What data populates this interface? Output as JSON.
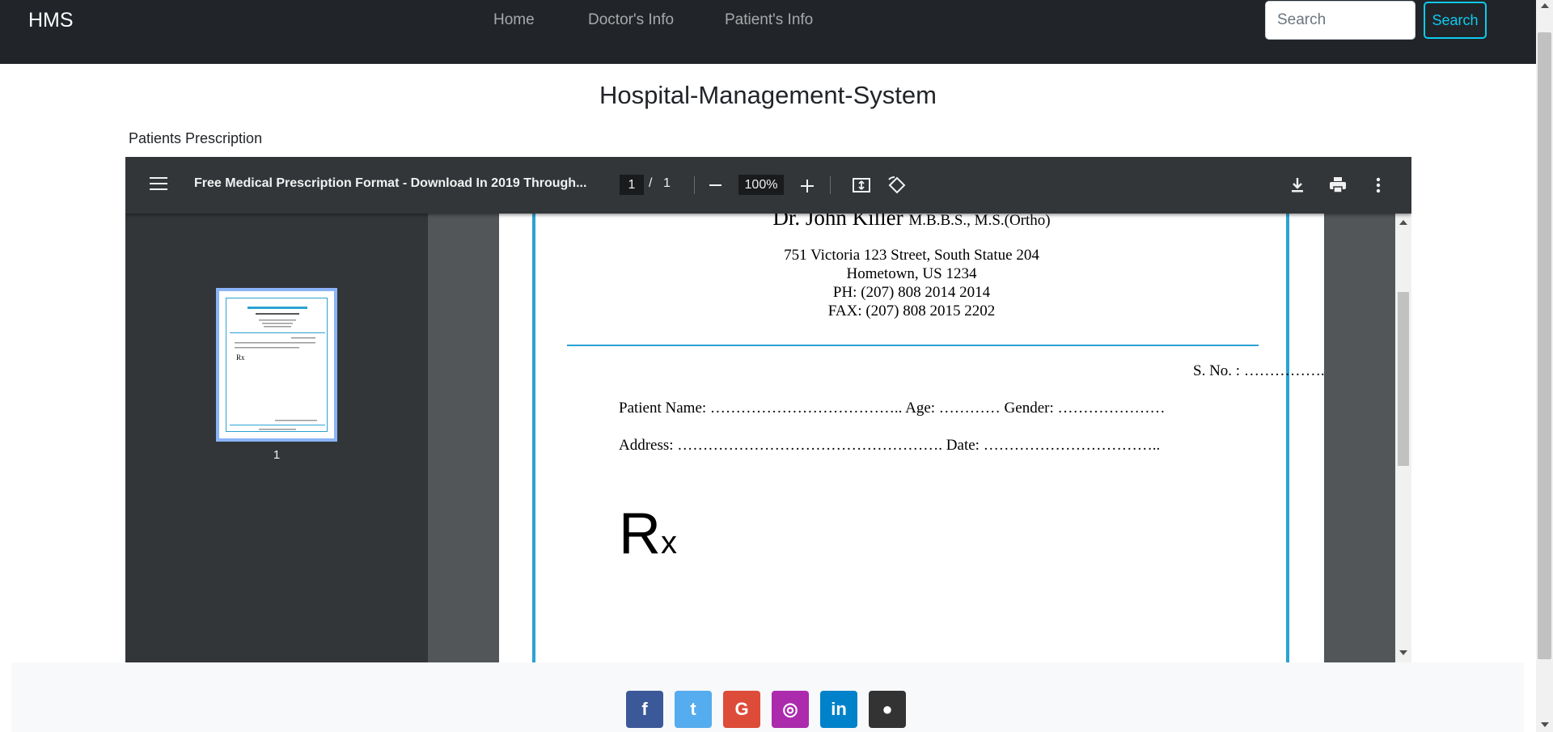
{
  "navbar": {
    "brand": "HMS",
    "links": [
      {
        "label": "Home"
      },
      {
        "label": "Doctor's Info"
      },
      {
        "label": "Patient's Info"
      }
    ],
    "search": {
      "placeholder": "Search",
      "button_label": "Search"
    }
  },
  "main": {
    "title": "Hospital-Management-System",
    "section_label": "Patients Prescription"
  },
  "pdf_viewer": {
    "file_title": "Free Medical Prescription Format - Download In 2019 Through...",
    "current_page": "1",
    "page_separator": "/",
    "total_pages": "1",
    "zoom": "100%",
    "thumbnail_page_number": "1",
    "document": {
      "doctor_name": "Dr. John Killer",
      "doctor_credentials": "M.B.B.S., M.S.(Ortho)",
      "address_line1": "751 Victoria 123 Street, South Statue 204",
      "address_line2": "Hometown, US 1234",
      "phone": "PH: (207) 808 2014 2014",
      "fax": "FAX: (207) 808 2015 2202",
      "serial_no": "S. No. : …………….",
      "patient_line": "Patient Name: ……………………………….. Age: ………… Gender: …………………",
      "address_line": "Address: ……………………………………………. Date: ……………………………..",
      "rx_symbol": "R",
      "rx_sub": "x"
    }
  },
  "footer": {
    "social": [
      {
        "name": "facebook",
        "glyph": "f",
        "color": "#3b5998"
      },
      {
        "name": "twitter",
        "glyph": "t",
        "color": "#55acee"
      },
      {
        "name": "google",
        "glyph": "G",
        "color": "#dd4b39"
      },
      {
        "name": "instagram",
        "glyph": "◎",
        "color": "#ac2bac"
      },
      {
        "name": "linkedin",
        "glyph": "in",
        "color": "#0082ca"
      },
      {
        "name": "github",
        "glyph": "●",
        "color": "#333333"
      }
    ]
  }
}
